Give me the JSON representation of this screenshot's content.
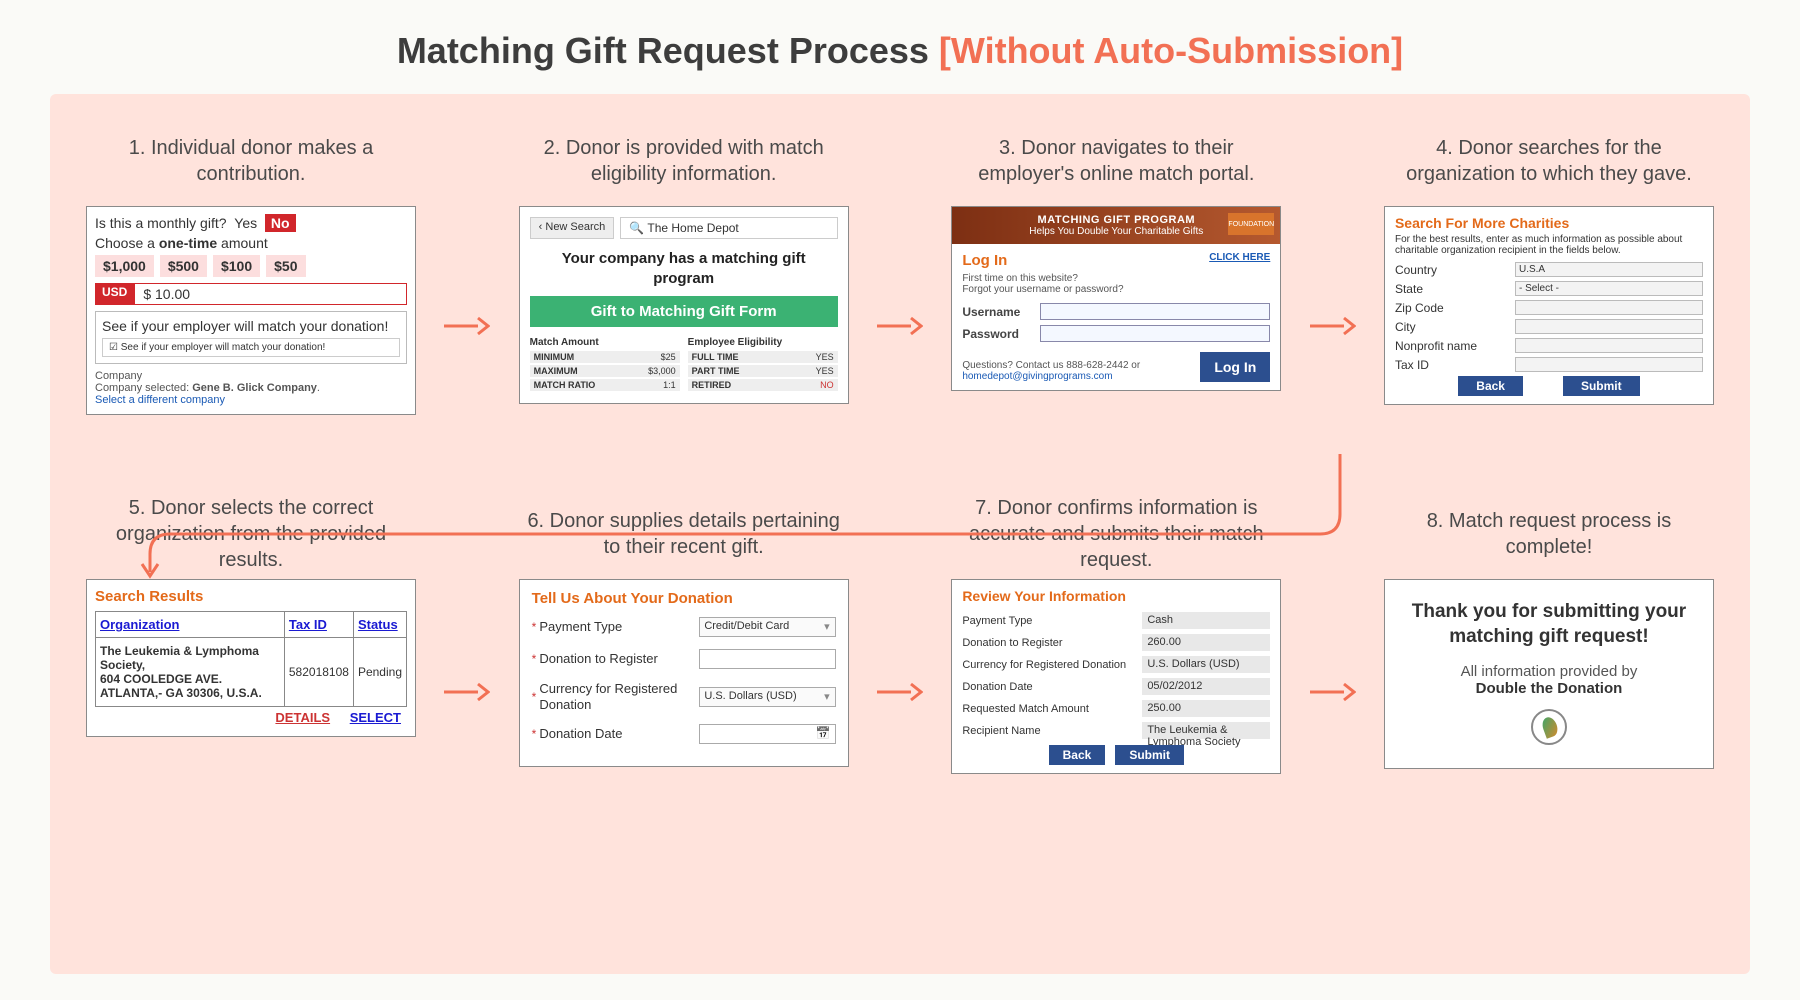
{
  "title_main": "Matching Gift Request Process ",
  "title_accent": "[Without Auto-Submission]",
  "steps": {
    "c1": "1. Individual donor makes a contribution.",
    "c2": "2. Donor is provided with match eligibility information.",
    "c3": "3. Donor navigates to their employer's online match portal.",
    "c4": "4. Donor searches for the organization to which they gave.",
    "c5": "5. Donor selects the correct organization from the provided results.",
    "c6": "6. Donor supplies details pertaining to their recent gift.",
    "c7": "7. Donor confirms information is accurate and submits their match request.",
    "c8": "8. Match request process is complete!"
  },
  "s1": {
    "q": "Is this a monthly gift?",
    "yes": "Yes",
    "no": "No",
    "choose_pre": "Choose a ",
    "choose_bold": "one-time",
    "choose_post": " amount",
    "amts": [
      "$1,000",
      "$500",
      "$100",
      "$50"
    ],
    "usd": "USD",
    "usd_amt": "$ 10.00",
    "match_hdr": "See if your employer will match your donation!",
    "match_sub": "☑ See if your employer will match your donation!",
    "company_lbl": "Company",
    "company_sel_pre": "Company selected: ",
    "company_sel_bold": "Gene B. Glick Company",
    "company_link": "Select a different company"
  },
  "s2": {
    "newsearch": "‹ New Search",
    "search_icon": "🔍",
    "search": "The Home Depot",
    "msg": "Your company has a matching gift program",
    "btn": "Gift to Matching Gift Form",
    "col1": "Match Amount",
    "col2": "Employee Eligibility",
    "kv1": [
      [
        "MINIMUM",
        "$25"
      ],
      [
        "MAXIMUM",
        "$3,000"
      ],
      [
        "MATCH RATIO",
        "1:1"
      ]
    ],
    "kv2": [
      [
        "FULL TIME",
        "YES"
      ],
      [
        "PART TIME",
        "YES"
      ],
      [
        "RETIRED",
        "NO"
      ]
    ]
  },
  "s3": {
    "banner_big": "MATCHING GIFT PROGRAM",
    "banner_sub": "Helps You Double Your Charitable Gifts",
    "logo": "FOUNDATION",
    "login": "Log In",
    "click": "CLICK HERE",
    "hint": "First time on this website?\nForgot your username or password?",
    "user": "Username",
    "pass": "Password",
    "q": "Questions? Contact us 888-628-2442 or",
    "email": "homedepot@givingprograms.com",
    "loginbtn": "Log In"
  },
  "s4": {
    "hdr": "Search For More Charities",
    "sub": "For the best results, enter as much information as possible about charitable organization recipient in the fields below.",
    "fields": [
      "Country",
      "State",
      "Zip Code",
      "City",
      "Nonprofit name",
      "Tax ID"
    ],
    "vals": [
      "U.S.A",
      "- Select -",
      "",
      "",
      "",
      ""
    ],
    "back": "Back",
    "submit": "Submit"
  },
  "s5": {
    "hdr": "Search Results",
    "cols": [
      "Organization",
      "Tax ID",
      "Status"
    ],
    "org": "The Leukemia & Lymphoma Society,\n604 COOLEDGE AVE. ATLANTA,- GA 30306, U.S.A.",
    "taxid": "582018108",
    "status": "Pending",
    "details": "DETAILS",
    "select": "SELECT"
  },
  "s6": {
    "hdr": "Tell Us About Your Donation",
    "f1": "Payment Type",
    "v1": "Credit/Debit Card",
    "f2": "Donation to Register",
    "f3": "Currency for Registered Donation",
    "v3": "U.S. Dollars (USD)",
    "f4": "Donation Date"
  },
  "s7": {
    "hdr": "Review Your Information",
    "rows": [
      [
        "Payment Type",
        "Cash"
      ],
      [
        "Donation to Register",
        "260.00"
      ],
      [
        "Currency for Registered Donation",
        "U.S. Dollars (USD)"
      ],
      [
        "Donation Date",
        "05/02/2012"
      ],
      [
        "Requested Match Amount",
        "250.00"
      ],
      [
        "Recipient Name",
        "The Leukemia & Lymphoma Society"
      ]
    ],
    "back": "Back",
    "submit": "Submit"
  },
  "s8": {
    "thanks": "Thank you for submitting your matching gift request!",
    "info": "All information provided by",
    "dtd": "Double the Donation"
  }
}
